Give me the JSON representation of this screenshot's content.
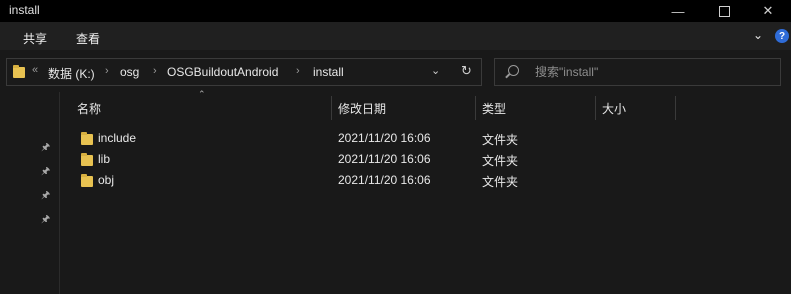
{
  "window": {
    "title": "install"
  },
  "ribbon": {
    "tabs": [
      "共享",
      "查看"
    ]
  },
  "address": {
    "overflow": "«",
    "crumbs": [
      "数据 (K:)",
      "osg",
      "OSGBuildoutAndroid",
      "install"
    ]
  },
  "search": {
    "placeholder": "搜索\"install\""
  },
  "columns": {
    "name": "名称",
    "modified": "修改日期",
    "type": "类型",
    "size": "大小"
  },
  "files": [
    {
      "name": "include",
      "modified": "2021/11/20 16:06",
      "type": "文件夹",
      "size": ""
    },
    {
      "name": "lib",
      "modified": "2021/11/20 16:06",
      "type": "文件夹",
      "size": ""
    },
    {
      "name": "obj",
      "modified": "2021/11/20 16:06",
      "type": "文件夹",
      "size": ""
    }
  ],
  "icons": {
    "folder": "folder-icon",
    "pin": "pin-icon",
    "search": "search-icon",
    "help": "help-icon",
    "refresh": "refresh-icon"
  },
  "colors": {
    "folder": "#e8c251",
    "background": "#191919",
    "titlebar": "#000000",
    "help": "#2f6cd8"
  }
}
